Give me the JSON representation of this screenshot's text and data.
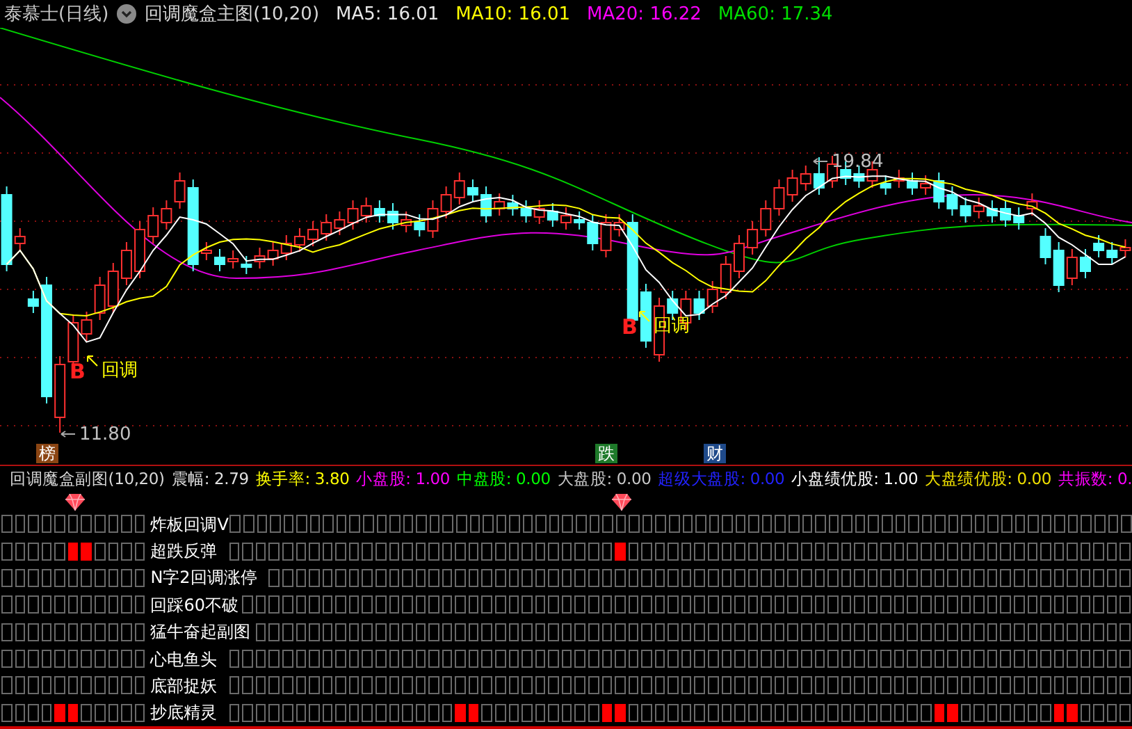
{
  "header": {
    "title": "泰慕士(日线)",
    "indicator": "回调魔盒主图(10,20)",
    "ma_values": [
      {
        "text": "MA5: 16.01",
        "color": "#e8e8e8"
      },
      {
        "text": "MA10: 16.01",
        "color": "#ffff00"
      },
      {
        "text": "MA20: 16.22",
        "color": "#ff00ff"
      },
      {
        "text": "MA60: 17.34",
        "color": "#00e000"
      }
    ]
  },
  "chart": {
    "price_labels": [
      "19.84",
      "11.80"
    ],
    "pullback_marks": [
      {
        "letter": "B",
        "label": "回调"
      },
      {
        "letter": "B",
        "label": "回调"
      }
    ]
  },
  "event_markers": [
    {
      "text": "榜",
      "color": "#8b4513"
    },
    {
      "text": "跌",
      "color": "#1e7a2a"
    },
    {
      "text": "财",
      "color": "#1f4a8a"
    }
  ],
  "sub_header": {
    "indicator": "回调魔盒副图(10,20)",
    "stats": [
      {
        "text": "震幅: 2.79",
        "color": "#e0e0e0"
      },
      {
        "text": "换手率: 3.80",
        "color": "#ffff00"
      },
      {
        "text": "小盘股: 1.00",
        "color": "#ff00ff"
      },
      {
        "text": "中盘股: 0.00",
        "color": "#00ff00"
      },
      {
        "text": "大盘股: 0.00",
        "color": "#c8c8c8"
      },
      {
        "text": "超级大盘股: 0.00",
        "color": "#2222ff"
      },
      {
        "text": "小盘绩优股: 1.00",
        "color": "#ffffff"
      },
      {
        "text": "大盘绩优股: 0.00",
        "color": "#f0e000"
      },
      {
        "text": "共振数: 0.",
        "color": "#ff00ff"
      }
    ]
  },
  "gems": [
    false,
    false,
    false,
    false,
    false,
    true,
    false,
    false,
    false,
    false,
    false,
    false,
    false,
    false,
    false,
    false,
    false,
    false,
    false,
    false,
    false,
    false,
    false,
    false,
    false,
    false,
    false,
    false,
    false,
    false,
    false,
    false,
    false,
    false,
    false,
    false,
    false,
    false,
    false,
    false,
    false,
    false,
    false,
    false,
    false,
    false,
    true,
    false,
    false,
    false,
    false,
    false,
    false,
    false,
    false,
    false,
    false,
    false,
    false,
    false,
    false,
    false,
    false,
    false,
    false,
    false,
    false,
    false,
    false,
    false,
    false,
    false,
    false,
    false,
    false,
    false,
    false,
    false,
    false,
    false,
    false,
    false,
    false,
    false,
    false
  ],
  "signal_rows": [
    {
      "label": "炸板回调V",
      "cells_left": [
        false,
        false,
        false,
        false,
        false,
        false,
        false,
        false,
        false,
        false,
        false
      ],
      "cells_right": [
        false,
        false,
        false,
        false,
        false,
        false,
        false,
        false,
        false,
        false,
        false,
        false,
        false,
        false,
        false,
        false,
        false,
        false,
        false,
        false,
        false,
        false,
        false,
        false,
        false,
        false,
        false,
        false,
        false,
        false,
        false,
        false,
        false,
        false,
        false,
        false,
        false,
        false,
        false,
        false,
        false,
        false,
        false,
        false,
        false,
        false,
        false,
        false,
        false,
        false,
        false,
        false,
        false,
        false,
        false,
        false,
        false,
        false,
        false,
        false,
        false,
        false,
        false,
        false,
        false,
        false,
        false,
        false
      ]
    },
    {
      "label": "超跌反弹",
      "cells_left": [
        false,
        false,
        false,
        false,
        false,
        true,
        true,
        false,
        false,
        false,
        false
      ],
      "cells_right": [
        false,
        false,
        false,
        false,
        false,
        false,
        false,
        false,
        false,
        false,
        false,
        false,
        false,
        false,
        false,
        false,
        false,
        false,
        false,
        false,
        false,
        false,
        false,
        false,
        false,
        false,
        false,
        false,
        false,
        true,
        false,
        false,
        false,
        false,
        false,
        false,
        false,
        false,
        false,
        false,
        false,
        false,
        false,
        false,
        false,
        false,
        false,
        false,
        false,
        false,
        false,
        false,
        false,
        false,
        false,
        false,
        false,
        false,
        false,
        false,
        false,
        false,
        false,
        false,
        false,
        false,
        false,
        false
      ]
    },
    {
      "label": "N字2回调涨停",
      "cells_left": [
        false,
        false,
        false,
        false,
        false,
        false,
        false,
        false,
        false,
        false,
        false
      ],
      "cells_right": [
        false,
        false,
        false,
        false,
        false,
        false,
        false,
        false,
        false,
        false,
        false,
        false,
        false,
        false,
        false,
        false,
        false,
        false,
        false,
        false,
        false,
        false,
        false,
        false,
        false,
        false,
        false,
        false,
        false,
        false,
        false,
        false,
        false,
        false,
        false,
        false,
        false,
        false,
        false,
        false,
        false,
        false,
        false,
        false,
        false,
        false,
        false,
        false,
        false,
        false,
        false,
        false,
        false,
        false,
        false,
        false,
        false,
        false,
        false,
        false,
        false,
        false,
        false,
        false,
        false
      ]
    },
    {
      "label": "回踩60不破",
      "cells_left": [
        false,
        false,
        false,
        false,
        false,
        false,
        false,
        false,
        false,
        false,
        false
      ],
      "cells_right": [
        false,
        false,
        false,
        false,
        false,
        false,
        false,
        false,
        false,
        false,
        false,
        false,
        false,
        false,
        false,
        false,
        false,
        false,
        false,
        false,
        false,
        false,
        false,
        false,
        false,
        false,
        false,
        false,
        false,
        false,
        false,
        false,
        false,
        false,
        false,
        false,
        false,
        false,
        false,
        false,
        false,
        false,
        false,
        false,
        false,
        false,
        false,
        false,
        false,
        false,
        false,
        false,
        false,
        false,
        false,
        false,
        false,
        false,
        false,
        false,
        false,
        false,
        false,
        false,
        false,
        false,
        false
      ]
    },
    {
      "label": "猛牛奋起副图",
      "cells_left": [
        false,
        false,
        false,
        false,
        false,
        false,
        false,
        false,
        false,
        false,
        false
      ],
      "cells_right": [
        false,
        false,
        false,
        false,
        false,
        false,
        false,
        false,
        false,
        false,
        false,
        false,
        false,
        false,
        false,
        false,
        false,
        false,
        false,
        false,
        false,
        false,
        false,
        false,
        false,
        false,
        false,
        false,
        false,
        false,
        false,
        false,
        false,
        false,
        false,
        false,
        false,
        false,
        false,
        false,
        false,
        false,
        false,
        false,
        false,
        false,
        false,
        false,
        false,
        false,
        false,
        false,
        false,
        false,
        false,
        false,
        false,
        false,
        false,
        false,
        false,
        false,
        false,
        false,
        false,
        false
      ]
    },
    {
      "label": "心电鱼头",
      "cells_left": [
        false,
        false,
        false,
        false,
        false,
        false,
        false,
        false,
        false,
        false,
        false
      ],
      "cells_right": [
        false,
        false,
        false,
        false,
        false,
        false,
        false,
        false,
        false,
        false,
        false,
        false,
        false,
        false,
        false,
        false,
        false,
        false,
        false,
        false,
        false,
        false,
        false,
        false,
        false,
        false,
        false,
        false,
        false,
        false,
        false,
        false,
        false,
        false,
        false,
        false,
        false,
        false,
        false,
        false,
        false,
        false,
        false,
        false,
        false,
        false,
        false,
        false,
        false,
        false,
        false,
        false,
        false,
        false,
        false,
        false,
        false,
        false,
        false,
        false,
        false,
        false,
        false,
        false,
        false,
        false,
        false,
        false
      ]
    },
    {
      "label": "底部捉妖",
      "cells_left": [
        false,
        false,
        false,
        false,
        false,
        false,
        false,
        false,
        false,
        false,
        false
      ],
      "cells_right": [
        false,
        false,
        false,
        false,
        false,
        false,
        false,
        false,
        false,
        false,
        false,
        false,
        false,
        false,
        false,
        false,
        false,
        false,
        false,
        false,
        false,
        false,
        false,
        false,
        false,
        false,
        false,
        false,
        false,
        false,
        false,
        false,
        false,
        false,
        false,
        false,
        false,
        false,
        false,
        false,
        false,
        false,
        false,
        false,
        false,
        false,
        false,
        false,
        false,
        false,
        false,
        false,
        false,
        false,
        false,
        false,
        false,
        false,
        false,
        false,
        false,
        false,
        false,
        false,
        false,
        false,
        false,
        false
      ]
    },
    {
      "label": "抄底精灵",
      "cells_left": [
        false,
        false,
        false,
        false,
        true,
        true,
        false,
        false,
        false,
        false,
        false
      ],
      "cells_right": [
        false,
        false,
        false,
        false,
        false,
        false,
        false,
        false,
        false,
        false,
        false,
        false,
        false,
        false,
        false,
        false,
        false,
        true,
        true,
        false,
        false,
        false,
        false,
        false,
        false,
        false,
        false,
        false,
        true,
        true,
        false,
        false,
        false,
        false,
        false,
        false,
        false,
        false,
        false,
        false,
        false,
        false,
        false,
        false,
        false,
        false,
        false,
        false,
        false,
        false,
        false,
        false,
        false,
        true,
        true,
        false,
        false,
        false,
        false,
        false,
        false,
        false,
        true,
        true,
        false,
        false,
        false,
        false
      ]
    }
  ]
}
